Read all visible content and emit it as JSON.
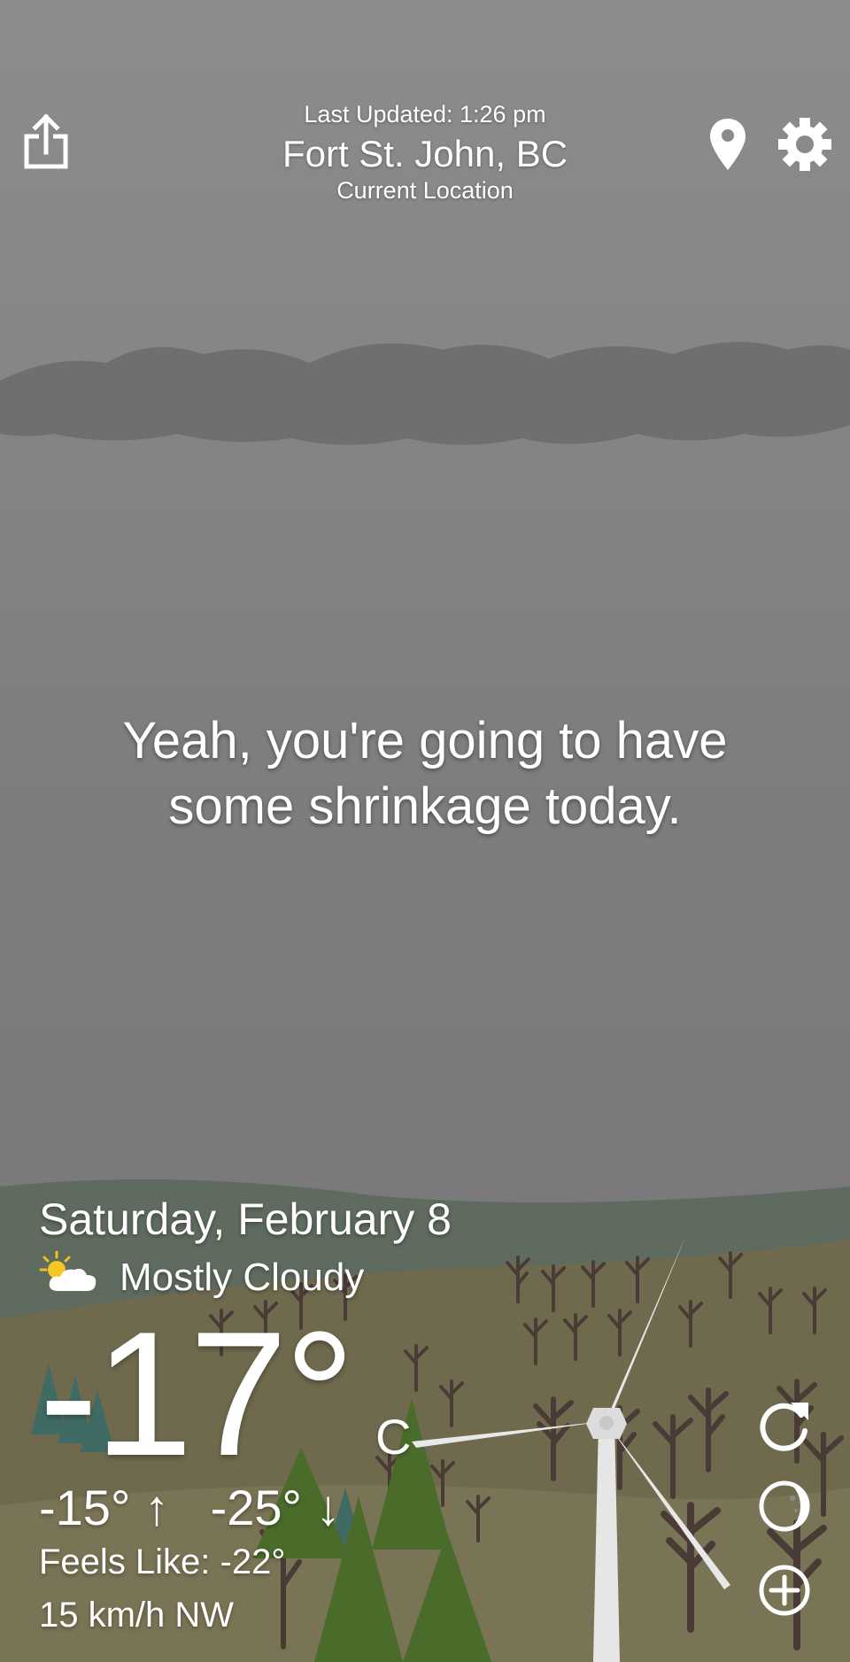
{
  "header": {
    "last_updated": "Last Updated: 1:26 pm",
    "city": "Fort St. John, BC",
    "location_label": "Current Location",
    "share_icon": "share-icon",
    "location_icon": "map-pin-icon",
    "settings_icon": "gear-icon"
  },
  "message": {
    "line1": "Yeah, you're going to have",
    "line2": "some shrinkage today."
  },
  "weather": {
    "date": "Saturday, February 8",
    "condition_icon": "partly-cloudy-icon",
    "condition": "Mostly Cloudy",
    "temperature": "-17°",
    "unit": "C",
    "high": "-15°",
    "high_arrow": "↑",
    "low": "-25°",
    "low_arrow": "↓",
    "feels_like": "Feels Like: -22°",
    "wind": "15 km/h NW"
  },
  "actions": {
    "refresh_icon": "refresh-icon",
    "moon_icon": "moon-icon",
    "add_icon": "add-icon"
  },
  "colors": {
    "sky": "#8a8a8a",
    "cloud_band": "#6e6e6e",
    "hill_far": "#59685b",
    "field": "#6e6a4f",
    "tree_green": "#4a6b2a",
    "trunk": "#4b3b36",
    "text": "#ffffff"
  }
}
